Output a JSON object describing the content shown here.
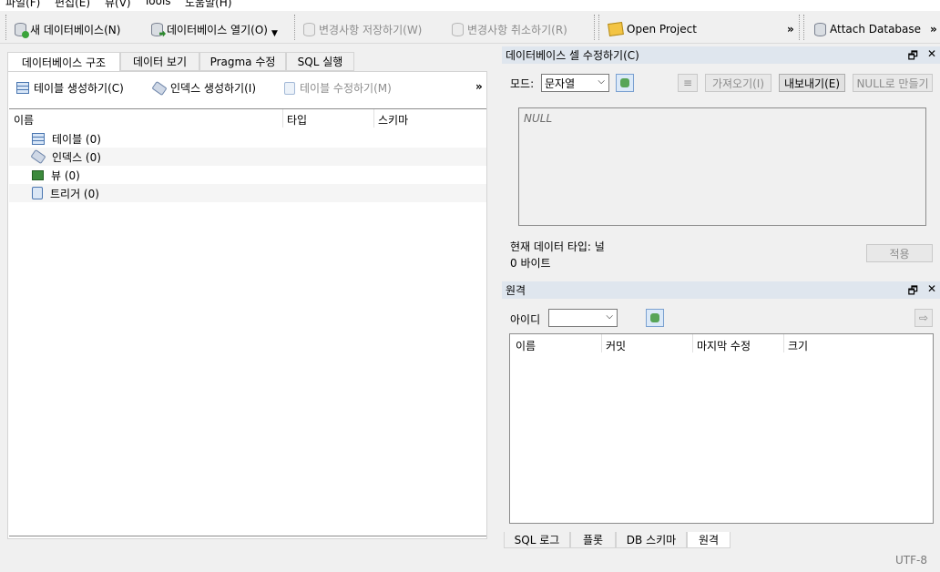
{
  "menu": [
    "파일(F)",
    "편집(E)",
    "뷰(V)",
    "Tools",
    "도움말(H)"
  ],
  "toolbar": {
    "new_db": "새 데이터베이스(N)",
    "open_db": "데이터베이스 열기(O)",
    "save_changes": "변경사항 저장하기(W)",
    "revert_changes": "변경사항 취소하기(R)",
    "open_project": "Open Project",
    "attach_db": "Attach Database",
    "overflow": "»"
  },
  "left_tabs": [
    "데이터베이스 구조",
    "데이터 보기",
    "Pragma 수정",
    "SQL 실행"
  ],
  "structure_toolbar": {
    "create_table": "테이블 생성하기(C)",
    "create_index": "인덱스 생성하기(I)",
    "modify_table": "테이블 수정하기(M)",
    "overflow": "»"
  },
  "tree": {
    "columns": [
      "이름",
      "타입",
      "스키마"
    ],
    "rows": [
      {
        "icon": "table-icon",
        "label": "테이블 (0)"
      },
      {
        "icon": "index-icon",
        "label": "인덱스 (0)"
      },
      {
        "icon": "view-icon",
        "label": "뷰 (0)"
      },
      {
        "icon": "trigger-icon",
        "label": "트리거 (0)"
      }
    ]
  },
  "cell_editor": {
    "title": "데이터베이스 셀 수정하기(C)",
    "mode_label": "모드:",
    "mode_value": "문자열",
    "import": "가져오기(I)",
    "export": "내보내기(E)",
    "set_null": "NULL로 만들기",
    "null_text": "NULL",
    "type_info": "현재 데이터 타입: 널",
    "size_info": "0 바이트",
    "apply": "적용"
  },
  "remote": {
    "title": "원격",
    "id_label": "아이디",
    "columns": [
      "이름",
      "커밋",
      "마지막 수정",
      "크기"
    ]
  },
  "bottom_tabs": [
    "SQL 로그",
    "플롯",
    "DB 스키마",
    "원격"
  ],
  "status": {
    "encoding": "UTF-8"
  },
  "dock_buttons": {
    "float": "🗗",
    "close": "✕"
  }
}
